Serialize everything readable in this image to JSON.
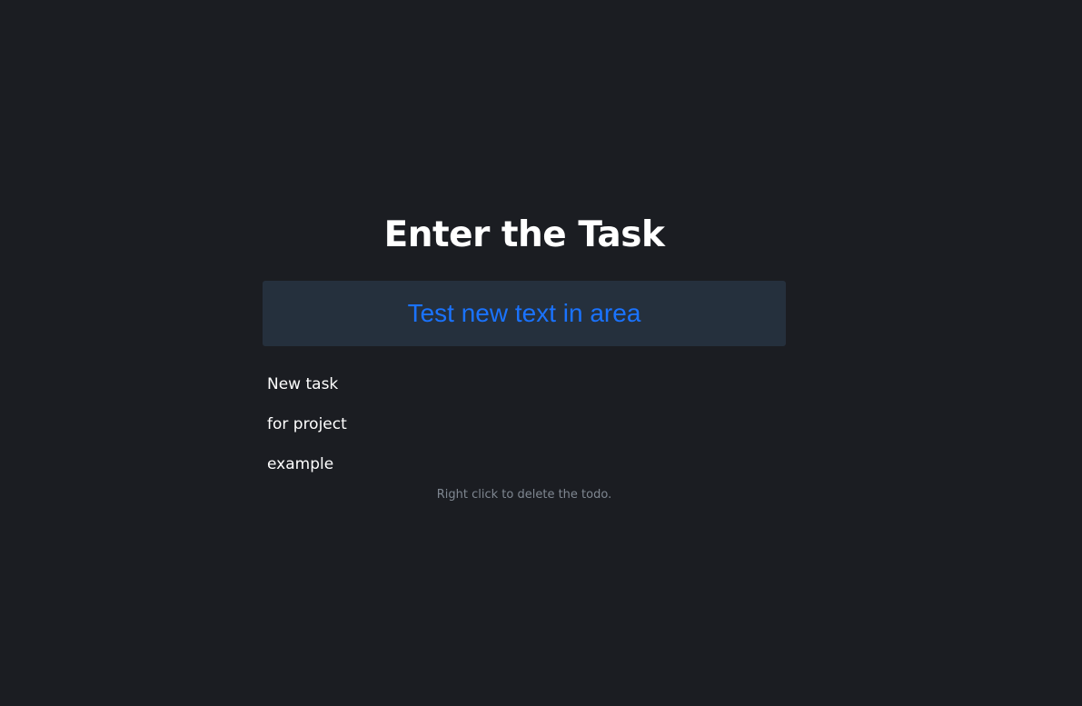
{
  "app": {
    "title": "Enter the Task",
    "input": {
      "value": "Test new text in area",
      "placeholder": ""
    },
    "todos": [
      {
        "text": "New task"
      },
      {
        "text": "for project"
      },
      {
        "text": "example"
      }
    ],
    "hint": "Right click to delete the todo."
  },
  "colors": {
    "background": "#1b1d22",
    "input_background": "#25303d",
    "input_text": "#1a73ff",
    "text": "#ffffff",
    "hint_text": "#7f8791"
  }
}
